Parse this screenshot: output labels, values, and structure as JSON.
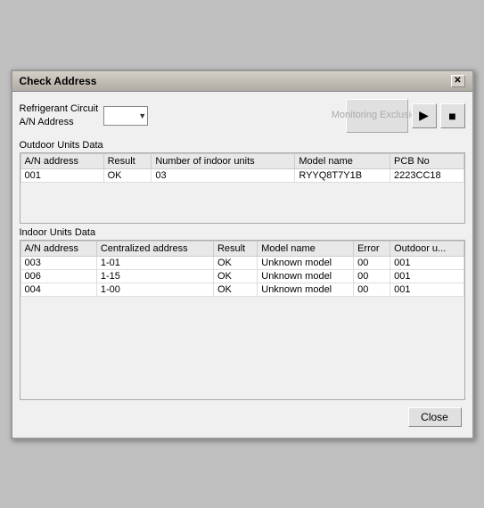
{
  "window": {
    "title": "Check Address",
    "close_label": "✕"
  },
  "top_controls": {
    "refrigerant_label_line1": "Refrigerant Circuit",
    "refrigerant_label_line2": "A/N Address",
    "monitoring_btn_line1": "Monitoring",
    "monitoring_btn_line2": "Exclusion",
    "play_icon": "▶",
    "stop_icon": "■"
  },
  "outdoor": {
    "section_label": "Outdoor Units Data",
    "columns": [
      "A/N address",
      "Result",
      "Number of indoor units",
      "Model name",
      "PCB No"
    ],
    "rows": [
      [
        "001",
        "OK",
        "03",
        "RYYQ8T7Y1B",
        "2223CC18"
      ]
    ]
  },
  "indoor": {
    "section_label": "Indoor Units Data",
    "columns": [
      "A/N address",
      "Centralized address",
      "Result",
      "Model name",
      "Error",
      "Outdoor u..."
    ],
    "rows": [
      [
        "003",
        "1-01",
        "OK",
        "Unknown model",
        "00",
        "001"
      ],
      [
        "006",
        "1-15",
        "OK",
        "Unknown model",
        "00",
        "001"
      ],
      [
        "004",
        "1-00",
        "OK",
        "Unknown model",
        "00",
        "001"
      ]
    ]
  },
  "footer": {
    "close_label": "Close"
  }
}
